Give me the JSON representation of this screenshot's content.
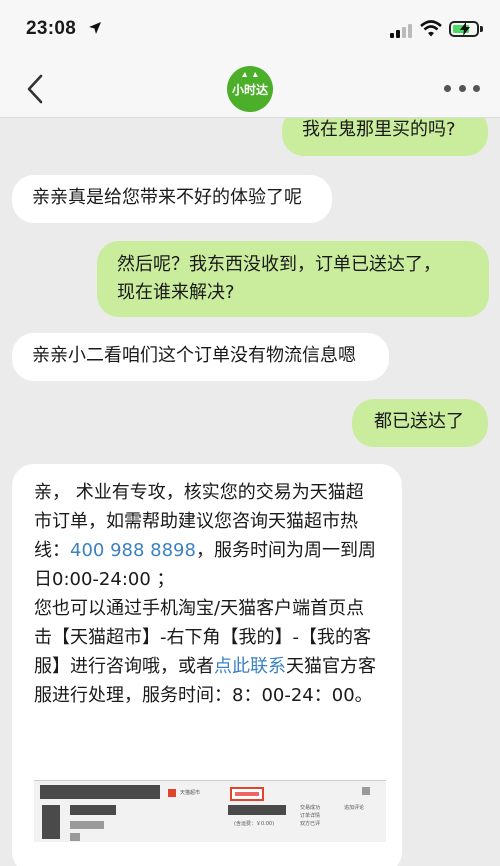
{
  "status_bar": {
    "time": "23:08",
    "icons": [
      "location-arrow-icon",
      "cellular-signal-icon",
      "wifi-icon",
      "battery-charging-icon"
    ]
  },
  "nav": {
    "back_icon": "chevron-left-icon",
    "logo_text": "小时达",
    "more_icon": "more-dots-icon",
    "brand_color": "#4caf2a"
  },
  "messages": [
    {
      "side": "out",
      "text": "我在鬼那里买的吗?"
    },
    {
      "side": "in",
      "text": "亲亲真是给您带来不好的体验了呢"
    },
    {
      "side": "out",
      "lines": [
        "然后呢？我东西没收到，订单已送达了，",
        "现在谁来解决?"
      ]
    },
    {
      "side": "in",
      "text": "亲亲小二看咱们这个订单没有物流信息嗯"
    },
    {
      "side": "out",
      "text": "都已送达了"
    },
    {
      "side": "in",
      "p1_before": "亲，  术业有专攻，核实您的交易为天猫超市订单，如需帮助建议您咨询天猫超市热线：",
      "phone": "400 988 8898",
      "p1_after": "，服务时间为周一到周日0:00-24:00  ；",
      "p2_before": "您也可以通过手机淘宝/天猫客户端首页点击【天猫超市】-右下角【我的】-【我的客服】进行咨询哦，或者",
      "p2_link": "点此联系",
      "p2_after": "天猫官方客服进行处理，服务时间：8：00-24：00。",
      "screenshot": {
        "tab_label": "天猫超市",
        "status_lines": [
          "交易成功",
          "订单详情",
          "双方已评"
        ],
        "action_label": "追加评论",
        "price_label": "(含运费：￥0.00)"
      }
    }
  ],
  "colors": {
    "outgoing_bubble": "#caec9d",
    "incoming_bubble": "#ffffff",
    "link": "#3b82c4",
    "chat_background": "#ebebeb"
  }
}
